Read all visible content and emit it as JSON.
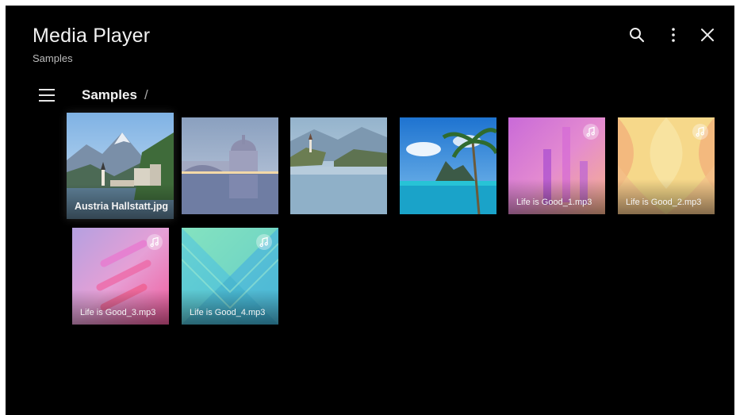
{
  "header": {
    "title": "Media Player",
    "subtitle": "Samples",
    "icons": [
      "search-icon",
      "more-vertical-icon",
      "close-icon"
    ]
  },
  "nav": {
    "breadcrumb": "Samples",
    "separator": "/"
  },
  "tiles": [
    {
      "label": "Austria Hallstatt.jpg",
      "type": "photo",
      "focused": true
    },
    {
      "label": "",
      "type": "photo"
    },
    {
      "label": "",
      "type": "photo"
    },
    {
      "label": "",
      "type": "photo"
    },
    {
      "label": "Life is Good_1.mp3",
      "type": "music"
    },
    {
      "label": "Life is Good_2.mp3",
      "type": "music"
    },
    {
      "label": "Life is Good_3.mp3",
      "type": "music"
    },
    {
      "label": "Life is Good_4.mp3",
      "type": "music"
    }
  ],
  "colors": {
    "background": "#000000",
    "text": "#f2f2f2",
    "subtext": "#bdbdbd"
  }
}
